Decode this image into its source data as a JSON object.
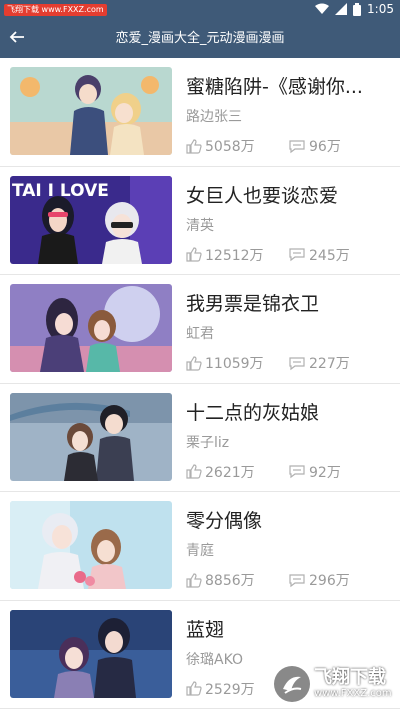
{
  "status_bar": {
    "watermark": "飞翔下载 www.FXXZ.com",
    "time": "1:05"
  },
  "app_bar": {
    "title": "恋爱_漫画大全_元动漫画漫画"
  },
  "comics": [
    {
      "title": "蜜糖陷阱-《感谢你...",
      "author": "路边张三",
      "likes": "5058万",
      "comments": "96万"
    },
    {
      "title": "女巨人也要谈恋爱",
      "author": "清英",
      "likes": "12512万",
      "comments": "245万"
    },
    {
      "title": "我男票是锦衣卫",
      "author": "虹君",
      "likes": "11059万",
      "comments": "227万"
    },
    {
      "title": "十二点的灰姑娘",
      "author": "栗子liz",
      "likes": "2621万",
      "comments": "92万"
    },
    {
      "title": "零分偶像",
      "author": "青庭",
      "likes": "8856万",
      "comments": "296万"
    },
    {
      "title": "蓝翅",
      "author": "徐璐AKO",
      "likes": "2529万",
      "comments": ""
    }
  ],
  "cover_art": [
    {
      "cover_text": ""
    },
    {
      "cover_text": "TAI  I LOVE"
    },
    {
      "cover_text": ""
    },
    {
      "cover_text": ""
    },
    {
      "cover_text": ""
    },
    {
      "cover_text": ""
    }
  ],
  "site_watermark": {
    "main": "飞翔下载",
    "sub": "www.FXXZ.com"
  },
  "colors": {
    "app_bar": "#3f5a78",
    "title_text": "#222222",
    "meta_text": "#9a9a9a"
  },
  "icons": {
    "back": "arrow-left-icon",
    "likes": "thumbs-up-icon",
    "comments": "comment-bubble-icon",
    "wifi": "wifi-icon",
    "signal": "signal-icon",
    "battery": "battery-icon"
  }
}
